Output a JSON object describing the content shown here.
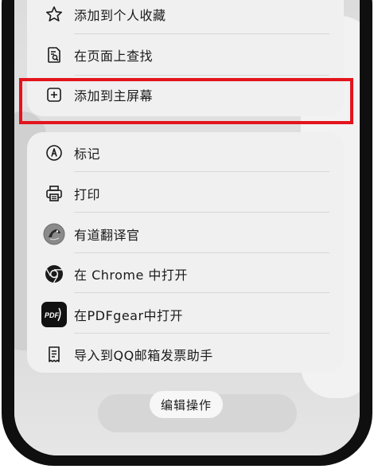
{
  "menu_top": {
    "items": [
      {
        "label": "添加到个人收藏",
        "icon": "star-icon"
      },
      {
        "label": "在页面上查找",
        "icon": "find-in-page-icon"
      },
      {
        "label": "添加到主屏幕",
        "icon": "add-square-icon"
      }
    ]
  },
  "menu_bottom": {
    "items": [
      {
        "label": "标记",
        "icon": "markup-pen-icon"
      },
      {
        "label": "打印",
        "icon": "printer-icon"
      },
      {
        "label": "有道翻译官",
        "icon": "youdao-translate-icon"
      },
      {
        "label": "在 Chrome 中打开",
        "icon": "chrome-icon"
      },
      {
        "label": "在PDFgear中打开",
        "icon": "pdfgear-icon"
      },
      {
        "label": "导入到QQ邮箱发票助手",
        "icon": "receipt-icon"
      }
    ]
  },
  "pdf_icon_text": "PDF",
  "edit_actions_label": "编辑操作",
  "highlight_color": "#e3141c"
}
